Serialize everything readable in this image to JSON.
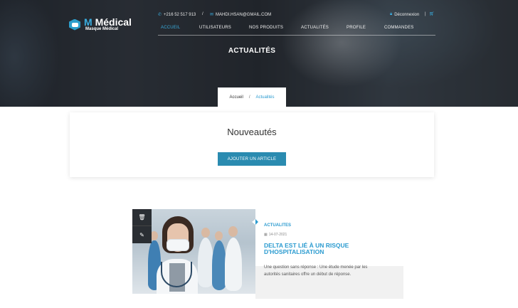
{
  "brand": {
    "name": "Médical",
    "name_prefix": "M",
    "tagline": "Masque Médical",
    "accent": "#3aaee0"
  },
  "topbar": {
    "phone": "+216 52 517 913",
    "separator": "/",
    "email": "MAHDI.HSAN@GMAIL.COM",
    "logout": "Déconnexion",
    "divider": "|"
  },
  "nav": {
    "items": [
      {
        "label": "ACCUEIL",
        "active": true
      },
      {
        "label": "UTILISATEURS"
      },
      {
        "label": "NOS PRODUITS"
      },
      {
        "label": "ACTUALITÉS"
      },
      {
        "label": "PROFILE"
      },
      {
        "label": "COMMANDES"
      }
    ]
  },
  "hero": {
    "title": "ACTUALITÉS"
  },
  "breadcrumb": {
    "home": "Accueil",
    "separator": "/",
    "current": "Actualités"
  },
  "main": {
    "title": "Nouveautés",
    "add_button": "AJOUTER UN ARTICLE"
  },
  "article": {
    "category": "ACTUALITES",
    "date": "14-07-2021",
    "title": "DELTA EST LIÉ À UN RISQUE D'HOSPITALISATION",
    "excerpt": "Une question sans réponse : Une étude menée par les autorités sanitaires offre un début de réponse.",
    "image_alt": "medical-staff-photo"
  },
  "icons": {
    "phone": "phone-icon",
    "mail": "mail-icon",
    "lock": "lock-icon",
    "cart": "cart-icon",
    "trash": "trash-icon",
    "edit": "edit-icon",
    "calendar": "calendar-icon"
  }
}
